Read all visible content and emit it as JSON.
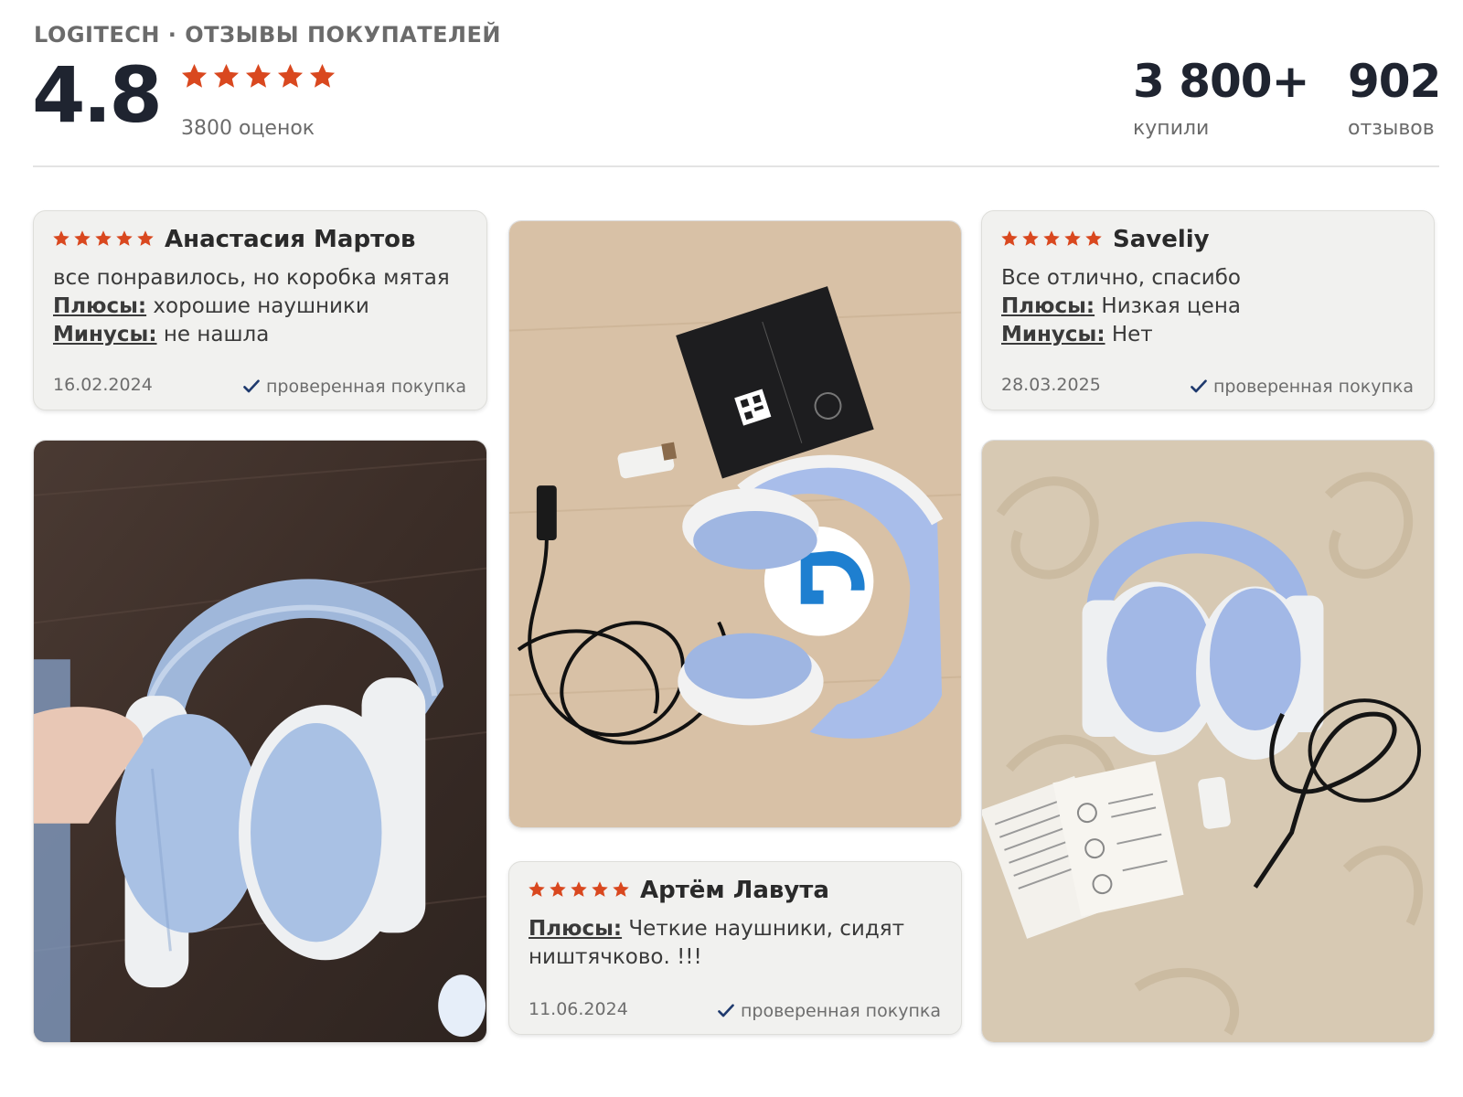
{
  "header": {
    "brand": "LOGITECH · ОТЗЫВЫ ПОКУПАТЕЛЕЙ",
    "rating": "4.8",
    "stars": 5,
    "ratings_count": "3800 оценок",
    "buyers_value": "3 800+",
    "buyers_label": "купили",
    "reviews_value": "902",
    "reviews_label": "отзывов"
  },
  "colors": {
    "star": "#d9481f",
    "verified_check": "#1f3a6e",
    "card_bg": "#f1f1ef"
  },
  "reviews": [
    {
      "stars": 5,
      "author": "Анастасия Мартов",
      "text": "все понравилось, но коробка мятая",
      "pros_label": "Плюсы:",
      "pros": "хорошие наушники",
      "cons_label": "Минусы:",
      "cons": "не нашла",
      "date": "16.02.2024",
      "verified": "проверенная покупка"
    },
    {
      "stars": 5,
      "author": "Saveliy",
      "text": "Все отлично, спасибо",
      "pros_label": "Плюсы:",
      "pros": "Низкая цена",
      "cons_label": "Минусы:",
      "cons": "Нет",
      "date": "28.03.2025",
      "verified": "проверенная покупка"
    },
    {
      "stars": 5,
      "author": "Артём Лавута",
      "pros_label": "Плюсы:",
      "pros": "Четкие наушники, сидят ништячково. !!!",
      "date": "11.06.2024",
      "verified": "проверенная покупка"
    }
  ],
  "photos": {
    "left": "headphones-held-in-hand-photo",
    "center": "headphones-box-and-cables-photo",
    "right": "headphones-on-carpet-photo"
  }
}
